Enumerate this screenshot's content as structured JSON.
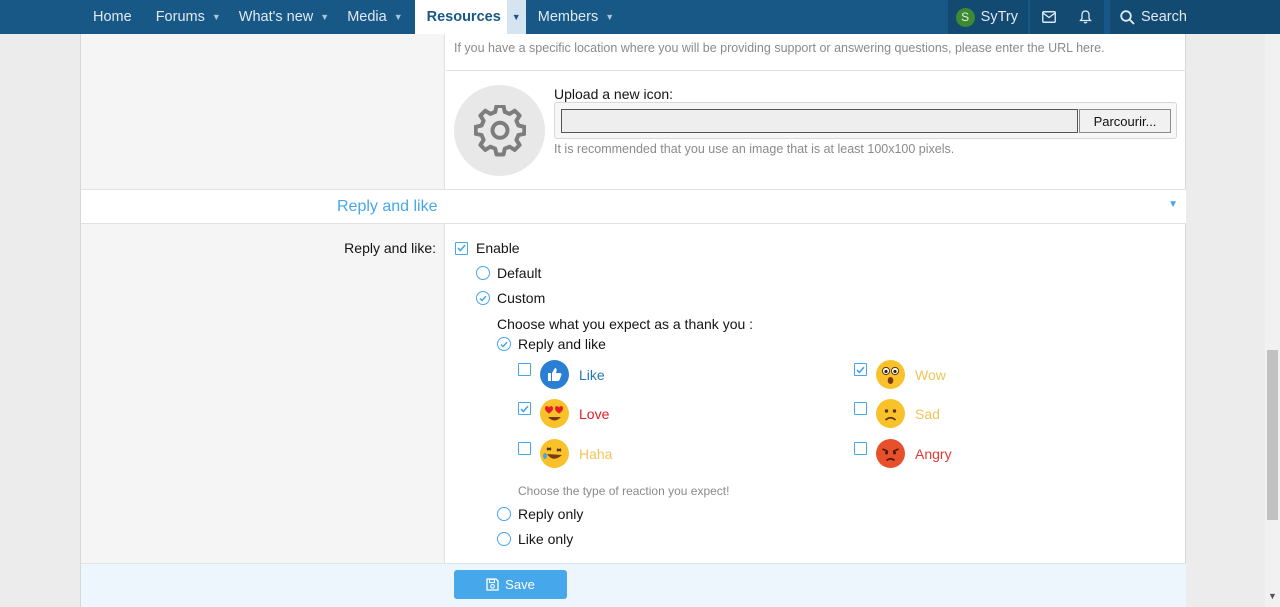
{
  "nav": {
    "tabs": [
      {
        "label": "Home"
      },
      {
        "label": "Forums"
      },
      {
        "label": "What's new"
      },
      {
        "label": "Media"
      },
      {
        "label": "Resources"
      },
      {
        "label": "Members"
      }
    ],
    "user": {
      "initial": "S",
      "name": "SyTry"
    },
    "search_label": "Search"
  },
  "form": {
    "support_url_hint": "If you have a specific location where you will be providing support or answering questions, please enter the URL here.",
    "upload_label": "Upload a new icon:",
    "browse_button": "Parcourir...",
    "upload_hint": "It is recommended that you use an image that is at least 100x100 pixels.",
    "section_title": "Reply and like",
    "field_label": "Reply and like:",
    "enable_label": "Enable",
    "enable_checked": true,
    "mode_options": [
      {
        "label": "Default",
        "selected": false
      },
      {
        "label": "Custom",
        "selected": true
      }
    ],
    "thank_you_prompt": "Choose what you expect as a thank you :",
    "expect_options": [
      {
        "label": "Reply and like",
        "selected": true
      },
      {
        "label": "Reply only",
        "selected": false
      },
      {
        "label": "Like only",
        "selected": false
      }
    ],
    "reactions": [
      {
        "label": "Like",
        "checked": false,
        "color": "#2577b1",
        "icon": "thumbs-up-icon"
      },
      {
        "label": "Love",
        "checked": true,
        "color": "#e81c27",
        "icon": "heart-eyes-icon"
      },
      {
        "label": "Haha",
        "checked": false,
        "color": "#fdd835",
        "icon": "laughing-icon"
      },
      {
        "label": "Wow",
        "checked": true,
        "color": "#fdd835",
        "icon": "wow-icon"
      },
      {
        "label": "Sad",
        "checked": false,
        "color": "#fdd835",
        "icon": "sad-icon"
      },
      {
        "label": "Angry",
        "checked": false,
        "color": "#e53935",
        "icon": "angry-icon"
      }
    ],
    "reaction_hint": "Choose the type of reaction you expect!",
    "save_label": "Save"
  }
}
